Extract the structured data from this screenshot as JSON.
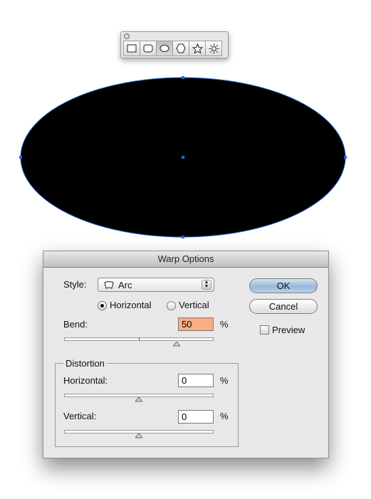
{
  "toolbar": {
    "tools": [
      {
        "name": "rectangle-tool",
        "icon": "rectangle-icon",
        "active": false
      },
      {
        "name": "rounded-rectangle-tool",
        "icon": "rounded-rectangle-icon",
        "active": false
      },
      {
        "name": "ellipse-tool",
        "icon": "ellipse-icon",
        "active": true
      },
      {
        "name": "polygon-tool",
        "icon": "polygon-icon",
        "active": false
      },
      {
        "name": "star-tool",
        "icon": "star-icon",
        "active": false
      },
      {
        "name": "flare-tool",
        "icon": "flare-icon",
        "active": false
      }
    ]
  },
  "canvas": {
    "shape": "ellipse",
    "fill": "#000000",
    "selection_color": "#2a63d8"
  },
  "dialog": {
    "title": "Warp Options",
    "style_label": "Style:",
    "style_value": "Arc",
    "style_icon": "arc-warp-icon",
    "orientation": {
      "horizontal_label": "Horizontal",
      "vertical_label": "Vertical",
      "selected": "horizontal"
    },
    "bend": {
      "label": "Bend:",
      "value": "50",
      "unit": "%",
      "slider_fraction": 0.75
    },
    "distortion": {
      "title": "Distortion",
      "horizontal": {
        "label": "Horizontal:",
        "value": "0",
        "unit": "%",
        "slider_fraction": 0.5
      },
      "vertical": {
        "label": "Vertical:",
        "value": "0",
        "unit": "%",
        "slider_fraction": 0.5
      }
    },
    "buttons": {
      "ok": "OK",
      "cancel": "Cancel"
    },
    "preview": {
      "label": "Preview",
      "checked": false
    },
    "colors": {
      "highlight_field": "#f7ae86",
      "default_button": "#a6c3e2"
    }
  }
}
